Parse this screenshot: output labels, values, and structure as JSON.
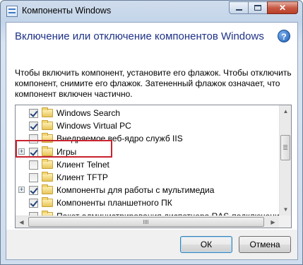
{
  "window": {
    "title": "Компоненты Windows"
  },
  "header": {
    "title": "Включение или отключение компонентов Windows",
    "help_glyph": "?"
  },
  "description": "Чтобы включить компонент, установите его флажок. Чтобы отключить компонент, снимите его флажок. Затененный флажок означает, что компонент включен частично.",
  "tree": {
    "items": [
      {
        "label": "Windows Search",
        "checked": true,
        "expandable": false
      },
      {
        "label": "Windows Virtual PC",
        "checked": true,
        "expandable": false
      },
      {
        "label": "Внедряемое веб-ядро служб IIS",
        "checked": false,
        "expandable": false
      },
      {
        "label": "Игры",
        "checked": true,
        "expandable": true,
        "highlighted": true
      },
      {
        "label": "Клиент Telnet",
        "checked": false,
        "expandable": false
      },
      {
        "label": "Клиент TFTP",
        "checked": false,
        "expandable": false
      },
      {
        "label": "Компоненты для работы с мультимедиа",
        "checked": true,
        "expandable": true
      },
      {
        "label": "Компоненты планшетного ПК",
        "checked": true,
        "expandable": false
      },
      {
        "label": "Пакет администрирования диспетчера RAS-подключений",
        "checked": false,
        "expandable": false
      }
    ]
  },
  "buttons": {
    "ok": "ОК",
    "cancel": "Отмена"
  },
  "colors": {
    "heading": "#1e3287",
    "highlight": "#c8232e"
  }
}
